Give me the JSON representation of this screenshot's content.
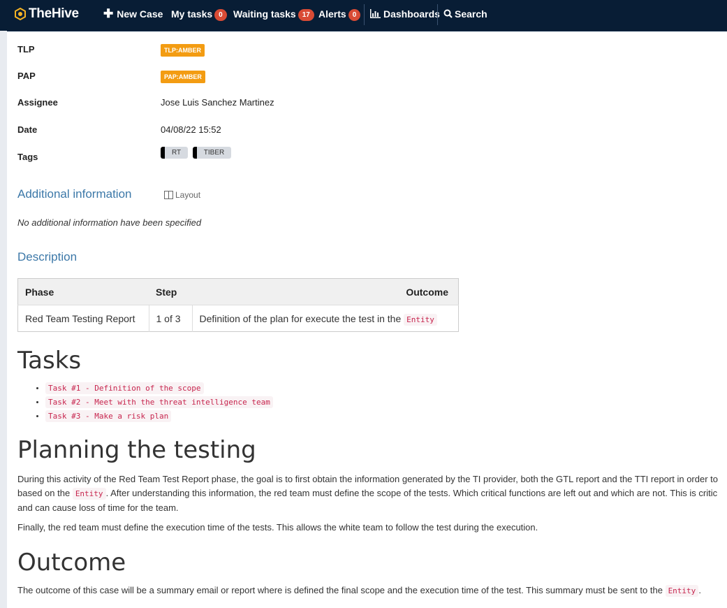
{
  "nav": {
    "brand": "TheHive",
    "new_case": "New Case",
    "my_tasks": "My tasks",
    "my_tasks_count": "0",
    "waiting_tasks": "Waiting tasks",
    "waiting_tasks_count": "17",
    "alerts": "Alerts",
    "alerts_count": "0",
    "dashboards": "Dashboards",
    "search": "Search"
  },
  "details": {
    "tlp_label": "TLP",
    "tlp_value": "TLP:AMBER",
    "pap_label": "PAP",
    "pap_value": "PAP:AMBER",
    "assignee_label": "Assignee",
    "assignee_value": "Jose Luis Sanchez Martinez",
    "date_label": "Date",
    "date_value": "04/08/22 15:52",
    "tags_label": "Tags",
    "tags": [
      "RT",
      "TIBER"
    ]
  },
  "additional": {
    "title": "Additional information",
    "layout_label": "Layout",
    "empty_note": "No additional information have been specified"
  },
  "description": {
    "title": "Description",
    "table": {
      "headers": [
        "Phase",
        "Step",
        "Outcome"
      ],
      "row": {
        "phase": "Red Team Testing Report",
        "step": "1 of 3",
        "outcome_text": "Definition of the plan for execute the test in the",
        "outcome_code": "Entity"
      }
    }
  },
  "tasks": {
    "heading": "Tasks",
    "items": [
      "Task #1 - Definition of the scope",
      "Task #2 - Meet with the threat intelligence team",
      "Task #3 - Make a risk plan"
    ]
  },
  "planning": {
    "heading": "Planning the testing",
    "p1_line1": "During this activity of the Red Team Test Report phase, the goal is to first obtain the information generated by the TI provider, both the GTL report and the TTI report in order to",
    "p1_line2_pre": "based on the",
    "p1_line2_code": "Entity",
    "p1_line2_post": ". After understanding this information, the red team must define the scope of the tests. Which critical functions are left out and which are not. This is critic",
    "p1_line3": "and can cause loss of time for the team.",
    "p2": "Finally, the red team must define the execution time of the tests. This allows the white team to follow the test during the execution."
  },
  "outcome": {
    "heading": "Outcome",
    "text_pre": "The outcome of this case will be a summary email or report where is defined the final scope and the execution time of the test. This summary must be sent to the",
    "code": "Entity",
    "text_post": "."
  },
  "colors": {
    "navbar": "#081d35",
    "amber": "#f39c12",
    "badge": "#d94b35",
    "section_title": "#3c78a8",
    "code_text": "#c7254e"
  }
}
